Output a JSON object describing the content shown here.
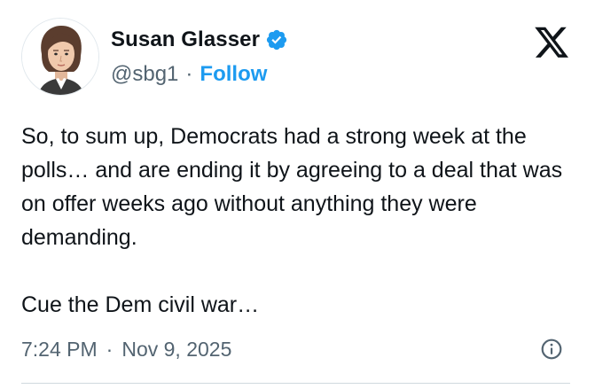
{
  "author": {
    "display_name": "Susan Glasser",
    "handle": "@sbg1",
    "separator": "·",
    "follow_label": "Follow",
    "verified": true
  },
  "tweet": {
    "paragraph_1": "So, to sum up, Democrats had a strong week at the polls… and are ending it by agreeing to a deal that was on offer weeks ago without anything they were demanding.",
    "paragraph_2": "Cue the Dem civil war…"
  },
  "meta": {
    "time": "7:24 PM",
    "separator": "·",
    "date": "Nov 9, 2025"
  },
  "icons": {
    "brand": "x-logo-icon",
    "verified": "verified-badge-icon",
    "info": "info-icon"
  },
  "colors": {
    "text": "#0f1419",
    "secondary": "#536471",
    "accent": "#1d9bf0",
    "divider": "#cfd9de"
  }
}
